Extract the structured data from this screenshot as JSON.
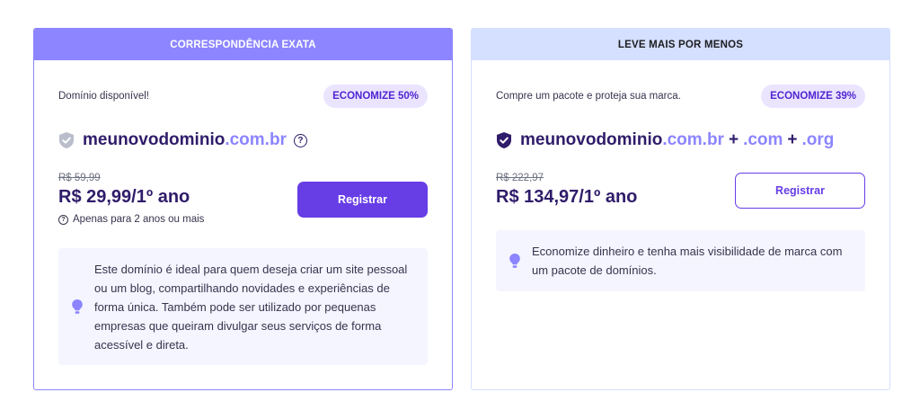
{
  "cards": [
    {
      "header": "CORRESPONDÊNCIA EXATA",
      "availability": "Domínio disponível!",
      "badge": "ECONOMIZE 50%",
      "domain": {
        "name": "meunovodominio",
        "tld": ".com.br"
      },
      "old_price": "R$ 59,99",
      "price": "R$ 29,99/1º ano",
      "note": "Apenas para 2 anos ou mais",
      "button": "Registrar",
      "info": "Este domínio é ideal para quem deseja criar um site pessoal ou um blog, compartilhando novidades e experiências de forma única. Também pode ser utilizado por pequenas empresas que queiram divulgar seus serviços de forma acessível e direta."
    },
    {
      "header": "LEVE MAIS POR MENOS",
      "availability": "Compre um pacote e proteja sua marca.",
      "badge": "ECONOMIZE 39%",
      "domain": {
        "name": "meunovodominio",
        "tld": ".com.br",
        "plus": "+",
        "tld2": ".com",
        "tld3": ".org"
      },
      "old_price": "R$ 222,97",
      "price": "R$ 134,97/1º ano",
      "button": "Registrar",
      "info": "Economize dinheiro e tenha mais visibilidade de marca com um pacote de domínios."
    }
  ],
  "icons": {
    "shield": "shield-check-icon",
    "help": "question-circle-icon",
    "bulb": "lightbulb-icon"
  },
  "colors": {
    "primary": "#673de6",
    "accent": "#8c85ff",
    "dark": "#2f1c6a",
    "badge_bg": "#ebe4ff",
    "info_bg": "#f4f5ff"
  }
}
